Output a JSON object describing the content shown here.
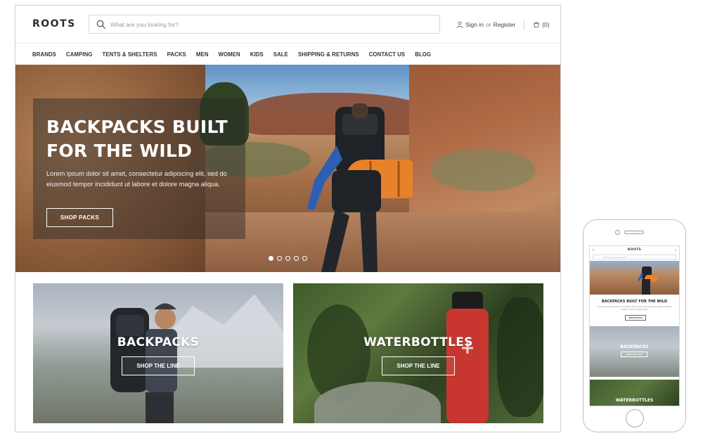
{
  "header": {
    "logo": "ROOTS",
    "search_placeholder": "What are you looking for?",
    "sign_in": "Sign in",
    "or": "or",
    "register": "Register",
    "cart_count": "(0)"
  },
  "nav": {
    "items": [
      "BRANDS",
      "CAMPING",
      "TENTS & SHELTERS",
      "PACKS",
      "MEN",
      "WOMEN",
      "KIDS",
      "SALE",
      "SHIPPING & RETURNS",
      "CONTACT US",
      "BLOG"
    ]
  },
  "hero": {
    "title": "BACKPACKS BUILT FOR THE WILD",
    "text": "Lorem ipsum dolor sit amet, consectetur adipiscing elit, sed do eiusmod tempor incididunt ut labore et dolore magna aliqua.",
    "button": "SHOP PACKS",
    "slide_count": 5,
    "active_slide": 1
  },
  "tiles": [
    {
      "title": "BACKPACKS",
      "button": "SHOP THE LINE"
    },
    {
      "title": "WATERBOTTLES",
      "button": "SHOP THE LINE"
    }
  ],
  "mobile": {
    "logo": "ROOTS",
    "hero_title": "BACKPACKS BUILT FOR THE WILD",
    "hero_button": "SHOP PACKS",
    "tile1_title": "BACKPACKS",
    "tile2_title": "WATERBOTTLES"
  },
  "colors": {
    "text_dark": "#333333",
    "border": "#cfcfcf",
    "bottle_red": "#c7372f",
    "sleeping_bag_orange": "#e8822a",
    "jacket_blue": "#2c5fb3"
  }
}
